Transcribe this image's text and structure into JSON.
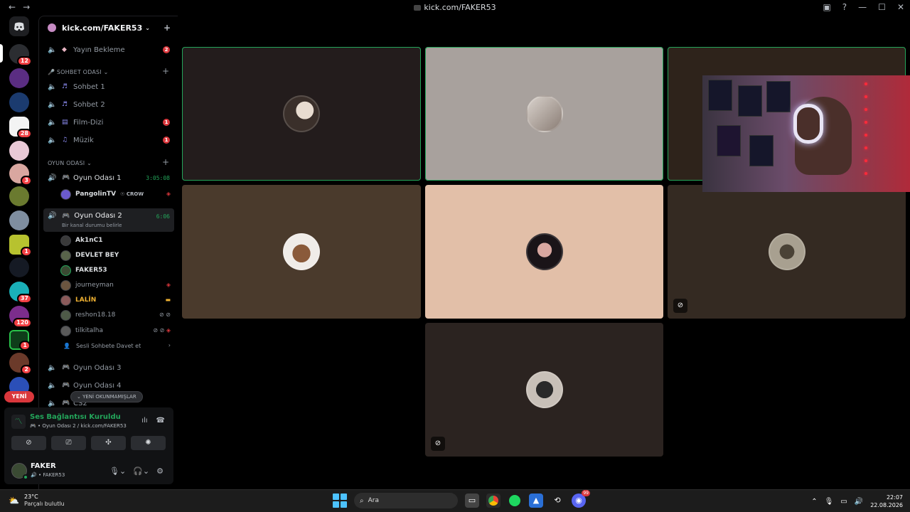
{
  "window": {
    "title": "kick.com/FAKER53",
    "back": "←",
    "forward": "→",
    "inbox_icon": "▣",
    "help_icon": "?",
    "min": "—",
    "max": "☐",
    "close": "✕"
  },
  "servers": {
    "badges": [
      "12",
      "28",
      "3",
      "1",
      "37",
      "120",
      "1",
      "2"
    ],
    "new_label": "YENİ"
  },
  "guild": {
    "name": "kick.com/FAKER53",
    "invite_icon": "+"
  },
  "channels": {
    "yayin": {
      "label": "Yayın Bekleme",
      "count": "2"
    },
    "cat_sohbet": "SOHBET ODASI",
    "sohbet1": "Sohbet 1",
    "sohbet2": "Sohbet 2",
    "film": {
      "label": "Film-Dizi",
      "count": "1"
    },
    "muzik": {
      "label": "Müzik",
      "count": "1"
    },
    "cat_oyun": "OYUN ODASI",
    "oyun1": {
      "label": "Oyun Odası 1",
      "timer": "3:05:08"
    },
    "oyun1_member": {
      "name": "PangolinTV",
      "tag": "CROW"
    },
    "oyun2": {
      "label": "Oyun Odası 2",
      "timer": "6:06",
      "status": "Bir kanal durumu belirle"
    },
    "members": [
      "Ak1nC1",
      "DEVLET BEY",
      "FAKER53",
      "journeyman",
      "LALİN",
      "reshon18.18",
      "tilkitalha"
    ],
    "invite": "Sesli Sohbete Davet et",
    "oyun3": "Oyun Odası 3",
    "oyun4": "Oyun Odası 4",
    "cs2": "CS2",
    "unread": "YENİ OKUNMAMIŞLAR"
  },
  "voice": {
    "status": "Ses Bağlantısı Kuruldu",
    "location": "Oyun Odası 2 / kick.com/FAKER53",
    "user_name": "FAKER",
    "user_sub": "FAKER53"
  },
  "taskbar": {
    "temp": "23°C",
    "weather": "Parçalı bulutlu",
    "search": "Ara",
    "time": "22:07",
    "date": "22.08.2026",
    "discord_badge": "99"
  },
  "colors": {
    "speaking": "#23a55a",
    "badge": "#da373c",
    "accent": "#5865f2"
  }
}
